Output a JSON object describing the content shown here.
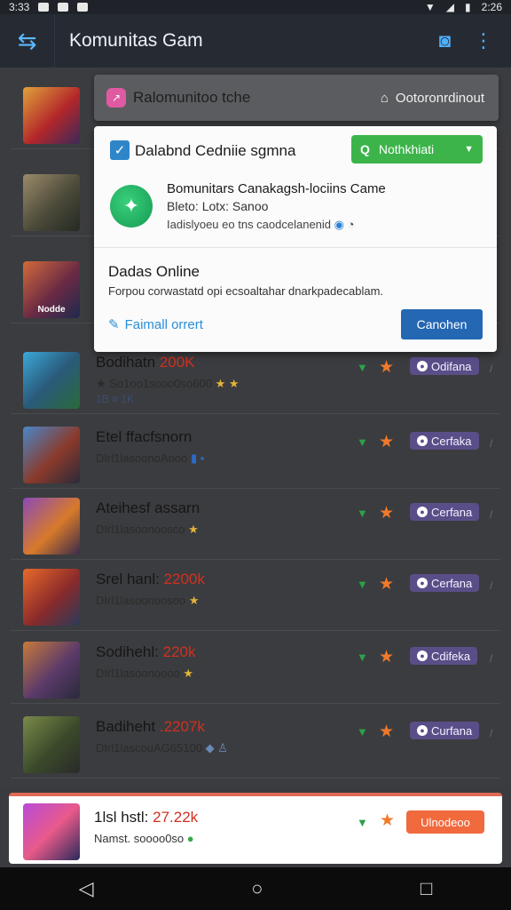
{
  "status_bar": {
    "left_text": "3:33",
    "time": "2:26"
  },
  "app_bar": {
    "title": "Komunitas Gam"
  },
  "popup_header": {
    "title": "Ralomunitoo tche",
    "right_label": "Ootoronrdinout"
  },
  "card": {
    "checkbox_label": "Dalabnd Cedniie sgmna",
    "green_button_label": "Nothkhiati",
    "game_name": "Bomunitars Canakagsh-lociins Came",
    "game_meta": "Bleto: Lotx: Sanoo",
    "game_desc": "Iadislyoeu eo tns caodcelanenid",
    "section_title": "Dadas Online",
    "section_desc": "Forpou corwastatd opi ecsoaltahar dnarkpadecablam.",
    "link_label": "Faimall orrert",
    "blue_button_label": "Canohen"
  },
  "rows": [
    {
      "thumb_label": "",
      "name": "",
      "name_highlight": "",
      "sub": "",
      "extra": "",
      "pill": ""
    },
    {
      "thumb_label": "",
      "name": "",
      "name_highlight": "",
      "sub": "",
      "extra": "",
      "pill": ""
    },
    {
      "thumb_label": "Nodde",
      "name": "",
      "name_highlight": "",
      "sub": "",
      "extra": "",
      "pill": ""
    },
    {
      "thumb_label": "",
      "name": "Bodihatn ",
      "name_highlight": "200K",
      "sub": "★ So1oo1sooo0so600",
      "sub_gold": "★ ★",
      "extra": "1B  ≡ 1K",
      "pill": "Odifana"
    },
    {
      "thumb_label": "",
      "name": "Etel ffacfsnorn",
      "name_highlight": "",
      "sub": "DIrl1lasoonoAooo",
      "sub_gold": "",
      "extra": "",
      "pill": "Cerfaka"
    },
    {
      "thumb_label": "",
      "name": "Ateihesf assarn",
      "name_highlight": "",
      "sub": "DIrl1lasoonoosco",
      "sub_gold": "★",
      "extra": "",
      "pill": "Cerfana"
    },
    {
      "thumb_label": "",
      "name": "Srel hanl: ",
      "name_highlight": "2200k",
      "sub": "DIrl1lasoonoosoo",
      "sub_gold": "★",
      "extra": "",
      "pill": "Cerfana"
    },
    {
      "thumb_label": "",
      "name": "Sodihehl: ",
      "name_highlight": "220k",
      "sub": "DIrl1lasoonoooo",
      "sub_gold": "★",
      "extra": "",
      "pill": "Cdifeka"
    },
    {
      "thumb_label": "",
      "name": "Badiheht ",
      "name_highlight": ".2207k",
      "sub": "DIrl1lascouAG65100",
      "sub_gold": "",
      "extra": "",
      "pill": "Curfana"
    }
  ],
  "featured": {
    "name": "1lsl hstl: ",
    "name_highlight": "27.22k",
    "sub": "Namst. soooo0so",
    "button_label": "Ulnodeoo"
  },
  "colors": {
    "accent_green": "#3cb44a",
    "accent_blue": "#2467b3",
    "accent_orange": "#f06a3e",
    "pill_purple": "#5a4e88",
    "star_orange": "#f07a2a"
  },
  "icons": [
    "menu-arrows-icon",
    "chat-icon",
    "more-vert-icon",
    "back-nav-icon",
    "home-nav-icon",
    "recents-nav-icon"
  ]
}
